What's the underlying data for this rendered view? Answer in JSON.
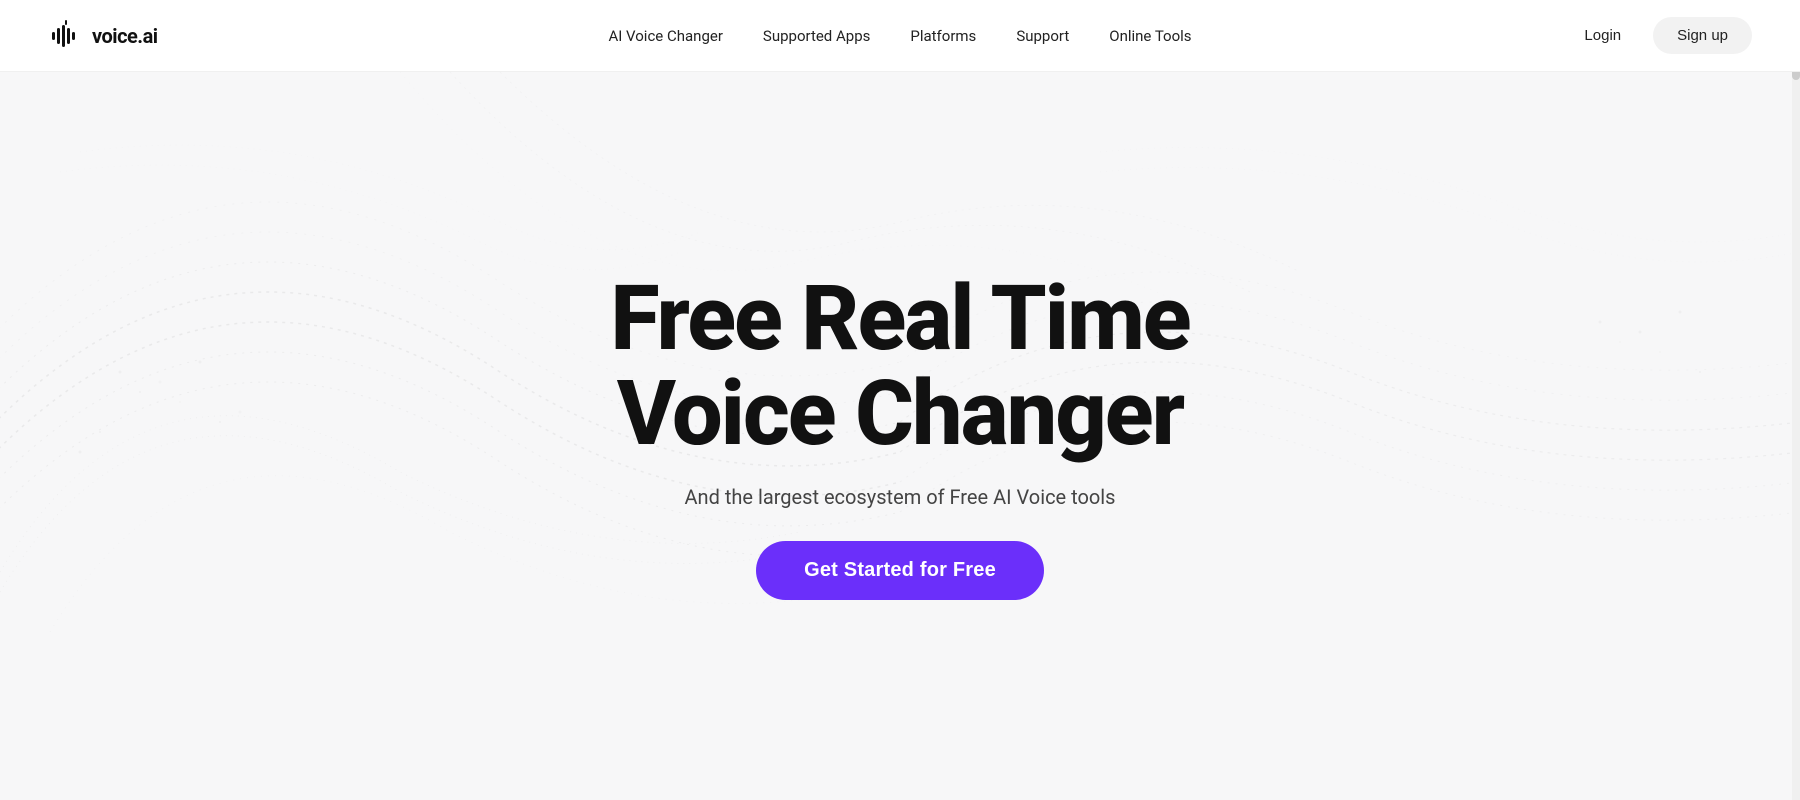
{
  "brand": {
    "logo_text": "voice.ai"
  },
  "nav": {
    "links": [
      {
        "label": "AI Voice Changer",
        "id": "ai-voice-changer"
      },
      {
        "label": "Supported Apps",
        "id": "supported-apps"
      },
      {
        "label": "Platforms",
        "id": "platforms"
      },
      {
        "label": "Support",
        "id": "support"
      },
      {
        "label": "Online Tools",
        "id": "online-tools"
      }
    ],
    "login_label": "Login",
    "signup_label": "Sign up"
  },
  "hero": {
    "title_line1": "Free Real Time",
    "title_line2": "Voice Changer",
    "subtitle": "And the largest ecosystem of Free AI Voice tools",
    "cta_label": "Get Started for Free"
  },
  "colors": {
    "cta_bg": "#6B2FFA",
    "cta_text": "#ffffff"
  }
}
